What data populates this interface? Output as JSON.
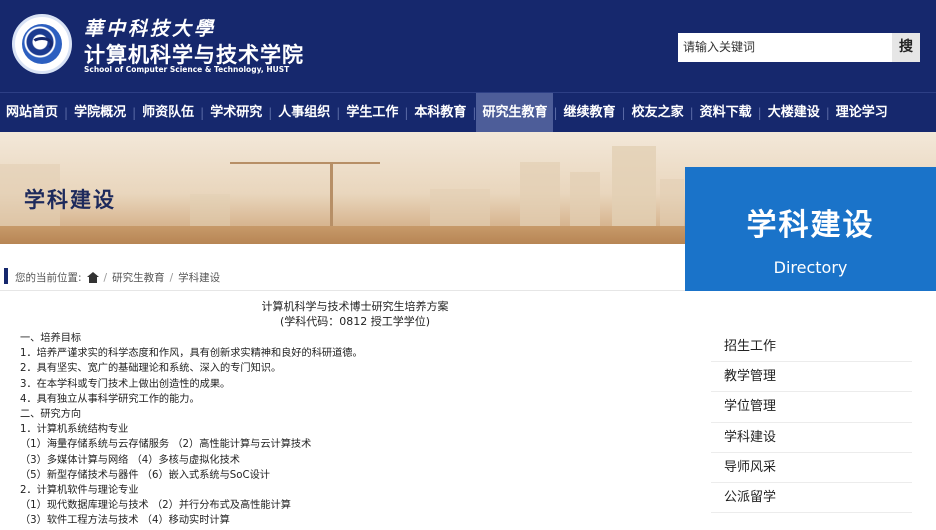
{
  "header": {
    "university_name": "華中科技大學",
    "school_name": "计算机科学与技术学院",
    "school_name_en": "School of Computer Science & Technology, HUST",
    "search_placeholder": "请输入关键词",
    "search_button": "搜"
  },
  "nav": {
    "items": [
      {
        "label": "网站首页",
        "active": false
      },
      {
        "label": "学院概况",
        "active": false
      },
      {
        "label": "师资队伍",
        "active": false
      },
      {
        "label": "学术研究",
        "active": false
      },
      {
        "label": "人事组织",
        "active": false
      },
      {
        "label": "学生工作",
        "active": false
      },
      {
        "label": "本科教育",
        "active": false
      },
      {
        "label": "研究生教育",
        "active": true
      },
      {
        "label": "继续教育",
        "active": false
      },
      {
        "label": "校友之家",
        "active": false
      },
      {
        "label": "资料下载",
        "active": false
      },
      {
        "label": "大楼建设",
        "active": false
      },
      {
        "label": "理论学习",
        "active": false
      }
    ]
  },
  "banner": {
    "title": "学科建设"
  },
  "directory": {
    "title": "学科建设",
    "subtitle": "Directory"
  },
  "breadcrumb": {
    "prefix": "您的当前位置:",
    "level1": "研究生教育",
    "level2": "学科建设",
    "separator": "/"
  },
  "article": {
    "title": "计算机科学与技术博士研究生培养方案",
    "subtitle": "(学科代码：0812 授工学学位)",
    "lines": [
      "一、培养目标",
      "1．培养严谨求实的科学态度和作风，具有创新求实精神和良好的科研道德。",
      "2．具有坚实、宽广的基础理论和系统、深入的专门知识。",
      "3．在本学科或专门技术上做出创造性的成果。",
      "4．具有独立从事科学研究工作的能力。",
      "二、研究方向",
      "1．计算机系统结构专业",
      "（1）海量存储系统与云存储服务 （2）高性能计算与云计算技术",
      "（3）多媒体计算与网络 （4）多核与虚拟化技术",
      "（5）新型存储技术与器件 （6）嵌入式系统与SoC设计",
      "2．计算机软件与理论专业",
      "（1）现代数据库理论与技术 （2）并行分布式及高性能计算",
      "（3）软件工程方法与技术 （4）移动实时计算"
    ]
  },
  "sidebar": {
    "items": [
      {
        "label": "招生工作"
      },
      {
        "label": "教学管理"
      },
      {
        "label": "学位管理"
      },
      {
        "label": "学科建设"
      },
      {
        "label": "导师风采"
      },
      {
        "label": "公派留学"
      }
    ]
  },
  "colors": {
    "header_bg": "#16286d",
    "nav_active_bg": "#4d5d99",
    "directory_bg": "#1a73c9",
    "banner_title": "#1d2a5c"
  },
  "icons": {
    "home": "home-icon",
    "logo": "hust-logo-icon"
  }
}
